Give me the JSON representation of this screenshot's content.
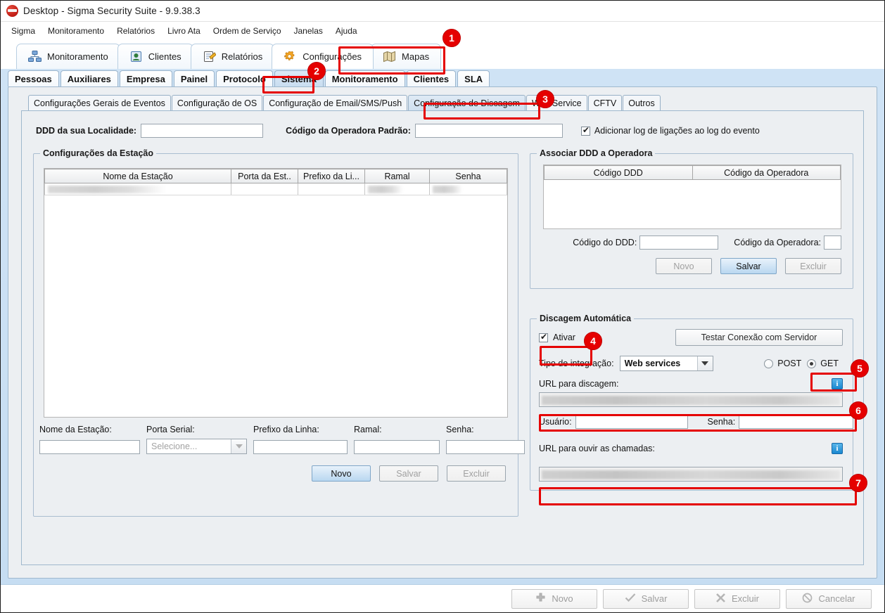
{
  "window": {
    "title": "Desktop - Sigma Security Suite - 9.9.38.3",
    "logo_name": "sigma-logo"
  },
  "menubar": {
    "items": [
      {
        "label": "Sigma"
      },
      {
        "label": "Monitoramento"
      },
      {
        "label": "Relatórios"
      },
      {
        "label": "Livro Ata"
      },
      {
        "label": "Ordem de Serviço"
      },
      {
        "label": "Janelas"
      },
      {
        "label": "Ajuda"
      }
    ]
  },
  "module_tabs": [
    {
      "label": "Monitoramento",
      "icon": "network-icon",
      "active": false
    },
    {
      "label": "Clientes",
      "icon": "contact-card-icon",
      "active": false
    },
    {
      "label": "Relatórios",
      "icon": "report-icon",
      "active": false
    },
    {
      "label": "Configurações",
      "icon": "gear-icon",
      "active": true
    },
    {
      "label": "Mapas",
      "icon": "map-icon",
      "active": false
    }
  ],
  "sub_tabs": [
    {
      "label": "Pessoas",
      "active": false
    },
    {
      "label": "Auxiliares",
      "active": false
    },
    {
      "label": "Empresa",
      "active": false
    },
    {
      "label": "Painel",
      "active": false
    },
    {
      "label": "Protocolo",
      "active": false
    },
    {
      "label": "Sistema",
      "active": true
    },
    {
      "label": "Monitoramento",
      "active": false
    },
    {
      "label": "Clientes",
      "active": false
    },
    {
      "label": "SLA",
      "active": false
    }
  ],
  "tab3": [
    {
      "label": "Configurações Gerais de Eventos",
      "active": false
    },
    {
      "label": "Configuração de OS",
      "active": false
    },
    {
      "label": "Configuração de  Email/SMS/Push",
      "active": false
    },
    {
      "label": "Configuração de Discagem",
      "active": true
    },
    {
      "label": "Web Service",
      "active": false
    },
    {
      "label": "CFTV",
      "active": false
    },
    {
      "label": "Outros",
      "active": false
    }
  ],
  "top_row": {
    "ddd_label": "DDD da sua Localidade:",
    "ddd_value": "",
    "operadora_label": "Código da Operadora Padrão:",
    "operadora_value": "",
    "log_checkbox_label": "Adicionar log de ligações ao log do evento",
    "log_checkbox_checked": true
  },
  "station_group": {
    "title": "Configurações da Estação",
    "columns": [
      "Nome da Estação",
      "Porta da Est..",
      "Prefixo da Li...",
      "Ramal",
      "Senha"
    ],
    "rows": [
      {
        "cells": [
          "",
          "",
          "",
          "",
          ""
        ],
        "redacted": [
          true,
          false,
          false,
          true,
          true
        ]
      }
    ],
    "form": {
      "fields": [
        {
          "label": "Nome da Estação:",
          "value": "",
          "type": "text"
        },
        {
          "label": "Porta Serial:",
          "value": "Selecione...",
          "type": "combo",
          "disabled": true
        },
        {
          "label": "Prefixo da Linha:",
          "value": "",
          "type": "text"
        },
        {
          "label": "Ramal:",
          "value": "",
          "type": "text"
        },
        {
          "label": "Senha:",
          "value": "",
          "type": "text"
        }
      ],
      "buttons": [
        {
          "label": "Novo",
          "state": "primary"
        },
        {
          "label": "Salvar",
          "state": "disabled"
        },
        {
          "label": "Excluir",
          "state": "disabled"
        }
      ]
    }
  },
  "ddd_group": {
    "title": "Associar DDD a Operadora",
    "columns": [
      "Código DDD",
      "Código da Operadora"
    ],
    "rows": [],
    "ddd_field_label": "Código do DDD:",
    "ddd_field_value": "",
    "operadora_field_label": "Código da Operadora:",
    "operadora_field_value": "",
    "buttons": [
      {
        "label": "Novo",
        "state": "disabled"
      },
      {
        "label": "Salvar",
        "state": "primary"
      },
      {
        "label": "Excluir",
        "state": "disabled"
      }
    ]
  },
  "dial_group": {
    "title": "Discagem Automática",
    "activate_label": "Ativar",
    "activate_checked": true,
    "test_button_label": "Testar Conexão com Servidor",
    "integration_label": "Tipo de integração:",
    "integration_value": "Web services",
    "integration_options": [
      "Web services"
    ],
    "method_post_label": "POST",
    "method_get_label": "GET",
    "method_selected": "GET",
    "url_dial_label": "URL para discagem:",
    "url_dial_value": "",
    "user_label": "Usuário:",
    "user_value": "",
    "password_label": "Senha:",
    "password_value": "",
    "url_listen_label": "URL para ouvir as chamadas:",
    "url_listen_value": "",
    "info_icon_glyph": "i"
  },
  "bottom_bar": {
    "buttons": [
      {
        "label": "Novo",
        "icon": "plus-icon"
      },
      {
        "label": "Salvar",
        "icon": "check-icon"
      },
      {
        "label": "Excluir",
        "icon": "x-icon"
      },
      {
        "label": "Cancelar",
        "icon": "ban-icon"
      }
    ]
  },
  "annotations": {
    "accent_color": "#e50000",
    "markers": [
      {
        "number": "1",
        "target": "module-tab-configuracoes"
      },
      {
        "number": "2",
        "target": "sub-tab-sistema"
      },
      {
        "number": "3",
        "target": "tab3-configuracao-de-discagem"
      },
      {
        "number": "4",
        "target": "dial-activate-checkbox"
      },
      {
        "number": "5",
        "target": "method-get-radio"
      },
      {
        "number": "6",
        "target": "url-dial-input"
      },
      {
        "number": "7",
        "target": "url-listen-input"
      }
    ]
  }
}
